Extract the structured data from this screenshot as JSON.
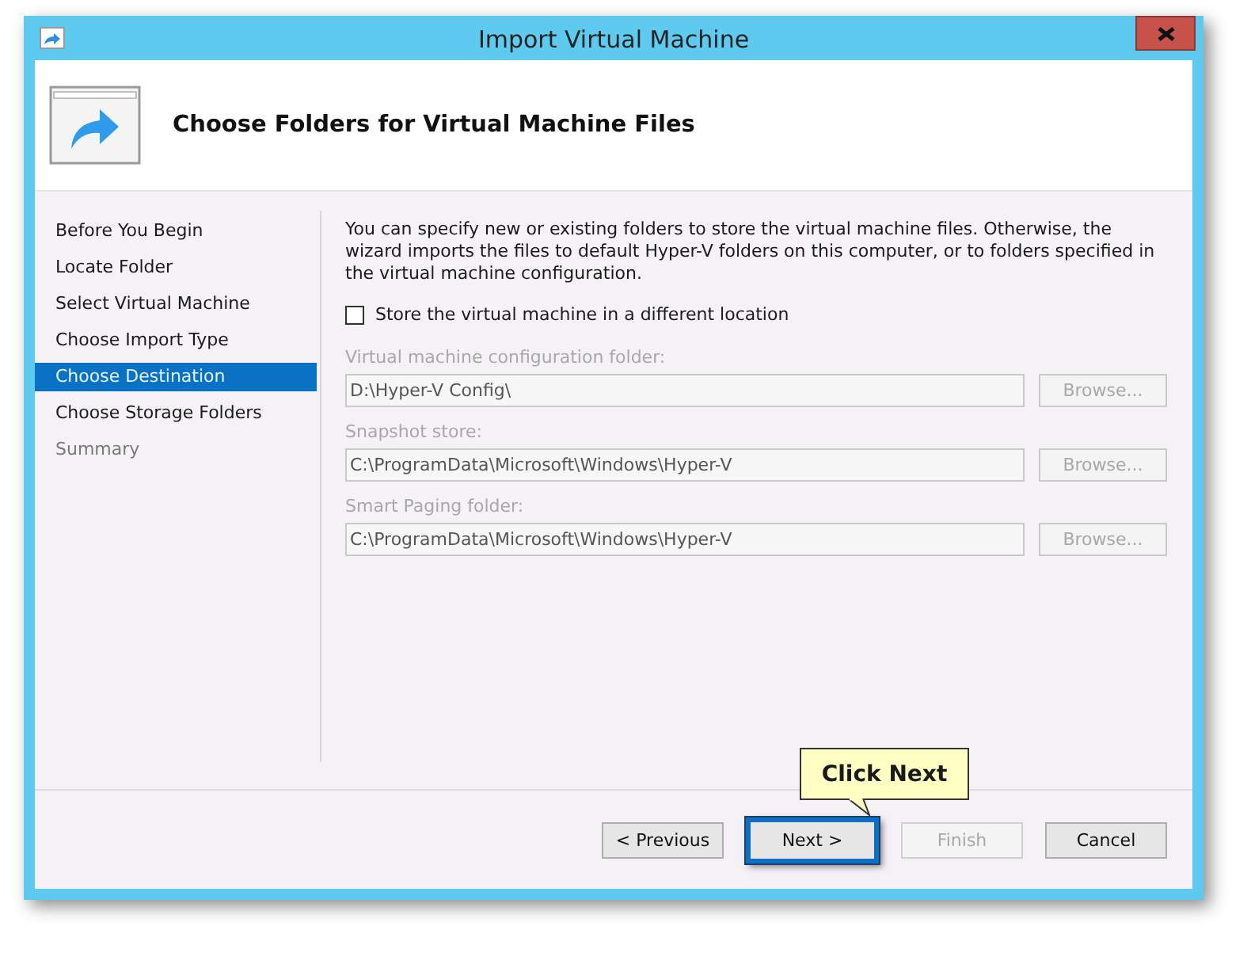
{
  "window": {
    "title": "Import Virtual Machine"
  },
  "header": {
    "title": "Choose Folders for Virtual Machine Files"
  },
  "steps": [
    {
      "label": "Before You Begin",
      "selected": false,
      "disabled": false
    },
    {
      "label": "Locate Folder",
      "selected": false,
      "disabled": false
    },
    {
      "label": "Select Virtual Machine",
      "selected": false,
      "disabled": false
    },
    {
      "label": "Choose Import Type",
      "selected": false,
      "disabled": false
    },
    {
      "label": "Choose Destination",
      "selected": true,
      "disabled": false
    },
    {
      "label": "Choose Storage Folders",
      "selected": false,
      "disabled": false
    },
    {
      "label": "Summary",
      "selected": false,
      "disabled": true
    }
  ],
  "description": "You can specify new or existing folders to store the virtual machine files. Otherwise, the wizard imports the files to default Hyper-V folders on this computer, or to folders specified in the virtual machine configuration.",
  "store_checkbox": {
    "label": "Store the virtual machine in a different location",
    "checked": false
  },
  "folders": [
    {
      "label": "Virtual machine configuration folder:",
      "value": "D:\\Hyper-V Config\\",
      "disabled": true,
      "browse": "Browse..."
    },
    {
      "label": "Snapshot store:",
      "value": "C:\\ProgramData\\Microsoft\\Windows\\Hyper-V",
      "disabled": true,
      "browse": "Browse..."
    },
    {
      "label": "Smart Paging folder:",
      "value": "C:\\ProgramData\\Microsoft\\Windows\\Hyper-V",
      "disabled": true,
      "browse": "Browse..."
    }
  ],
  "buttons": [
    {
      "label": "< Previous",
      "disabled": false,
      "highlighted": false
    },
    {
      "label": "Next >",
      "disabled": false,
      "highlighted": true
    },
    {
      "label": "Finish",
      "disabled": true,
      "highlighted": false
    },
    {
      "label": "Cancel",
      "disabled": false,
      "highlighted": false
    }
  ],
  "callout": {
    "text": "Click Next"
  }
}
